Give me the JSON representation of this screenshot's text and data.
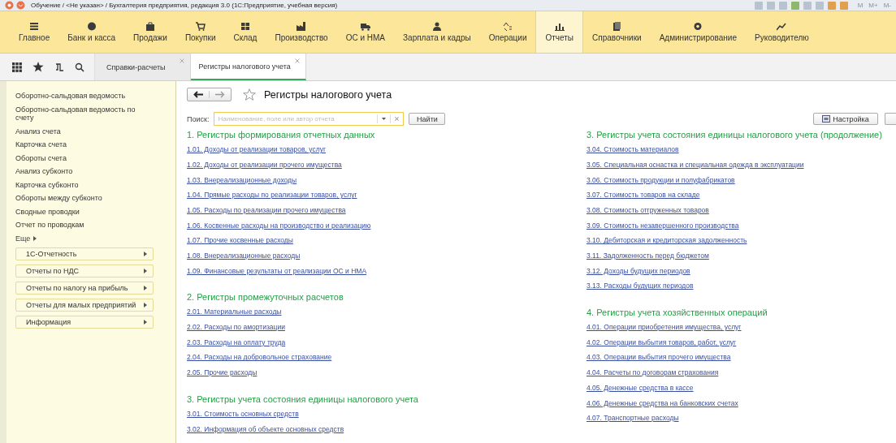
{
  "window": {
    "title": "Обучение / <Не указан> / Бухгалтерия предприятия, редакция 3.0  (1С:Предприятие, учебная версия)",
    "memory_buttons": [
      "M",
      "M+",
      "M-"
    ]
  },
  "sections_menu": [
    {
      "label": "Главное",
      "selected": false
    },
    {
      "label": "Банк и касса",
      "selected": false
    },
    {
      "label": "Продажи",
      "selected": false
    },
    {
      "label": "Покупки",
      "selected": false
    },
    {
      "label": "Склад",
      "selected": false
    },
    {
      "label": "Производство",
      "selected": false
    },
    {
      "label": "ОС и НМА",
      "selected": false
    },
    {
      "label": "Зарплата и кадры",
      "selected": false
    },
    {
      "label": "Операции",
      "selected": false
    },
    {
      "label": "Отчеты",
      "selected": true
    },
    {
      "label": "Справочники",
      "selected": false
    },
    {
      "label": "Администрирование",
      "selected": false
    },
    {
      "label": "Руководителю",
      "selected": false
    }
  ],
  "tabs": [
    {
      "label": "Справки-расчеты",
      "selected": false
    },
    {
      "label": "Регистры налогового учета",
      "selected": true
    }
  ],
  "sidebar": {
    "items": [
      "Оборотно-сальдовая ведомость",
      "Оборотно-сальдовая ведомость по счету",
      "Анализ счета",
      "Карточка счета",
      "Обороты счета",
      "Анализ субконто",
      "Карточка субконто",
      "Обороты между субконто",
      "Сводные проводки",
      "Отчет по проводкам"
    ],
    "more": "Еще",
    "groups": [
      "1С-Отчетность",
      "Отчеты по НДС",
      "Отчеты по налогу на прибыль",
      "Отчеты для малых предприятий",
      "Информация"
    ]
  },
  "page": {
    "title": "Регистры налогового учета",
    "search": {
      "label": "Поиск:",
      "placeholder": "Наименование, поле или автор отчета",
      "find_button": "Найти"
    },
    "settings_button": "Настройка",
    "columns": [
      [
        {
          "heading": "1. Регистры формирования отчетных данных",
          "links": [
            "1.01. Доходы от реализации товаров, услуг",
            "1.02. Доходы от реализации прочего имущества",
            "1.03. Внереализационные доходы",
            "1.04. Прямые расходы по реализации товаров, услуг",
            "1.05. Расходы по реализации прочего имущества",
            "1.06. Косвенные расходы на производство и реализацию",
            "1.07. Прочие косвенные расходы",
            "1.08. Внереализационные расходы",
            "1.09. Финансовые результаты от реализации ОС и НМА"
          ]
        },
        {
          "heading": "2. Регистры промежуточных расчетов",
          "links": [
            "2.01. Материальные расходы",
            "2.02. Расходы по амортизации",
            "2.03. Расходы на оплату труда",
            "2.04. Расходы на добровольное страхование",
            "2.05. Прочие расходы"
          ]
        },
        {
          "heading": "3. Регистры учета состояния единицы налогового учета",
          "links": [
            "3.01. Стоимость основных средств",
            "3.02. Информация об объекте основных средств"
          ]
        }
      ],
      [
        {
          "heading": "3. Регистры учета состояния единицы налогового учета (продолжение)",
          "links": [
            "3.04. Стоимость материалов",
            "3.05. Специальная оснастка и специальная одежда в эксплуатации",
            "3.06. Стоимость продукции и полуфабрикатов",
            "3.07. Стоимость товаров на складе",
            "3.08. Стоимость отгруженных товаров",
            "3.09. Стоимость незавершенного производства",
            "3.10. Дебиторская и кредиторская задолженность",
            "3.11. Задолженность перед бюджетом",
            "3.12. Доходы будущих периодов",
            "3.13. Расходы будущих периодов"
          ]
        },
        {
          "heading": "4. Регистры учета хозяйственных операций",
          "links": [
            "4.01. Операции приобретения имущества, услуг",
            "4.02. Операции выбытия товаров, работ, услуг",
            "4.03. Операции выбытия прочего имущества",
            "4.04. Расчеты по договорам страхования",
            "4.05. Денежные средства в кассе",
            "4.06. Денежные средства на банковских счетах",
            "4.07. Транспортные расходы"
          ]
        }
      ]
    ]
  }
}
